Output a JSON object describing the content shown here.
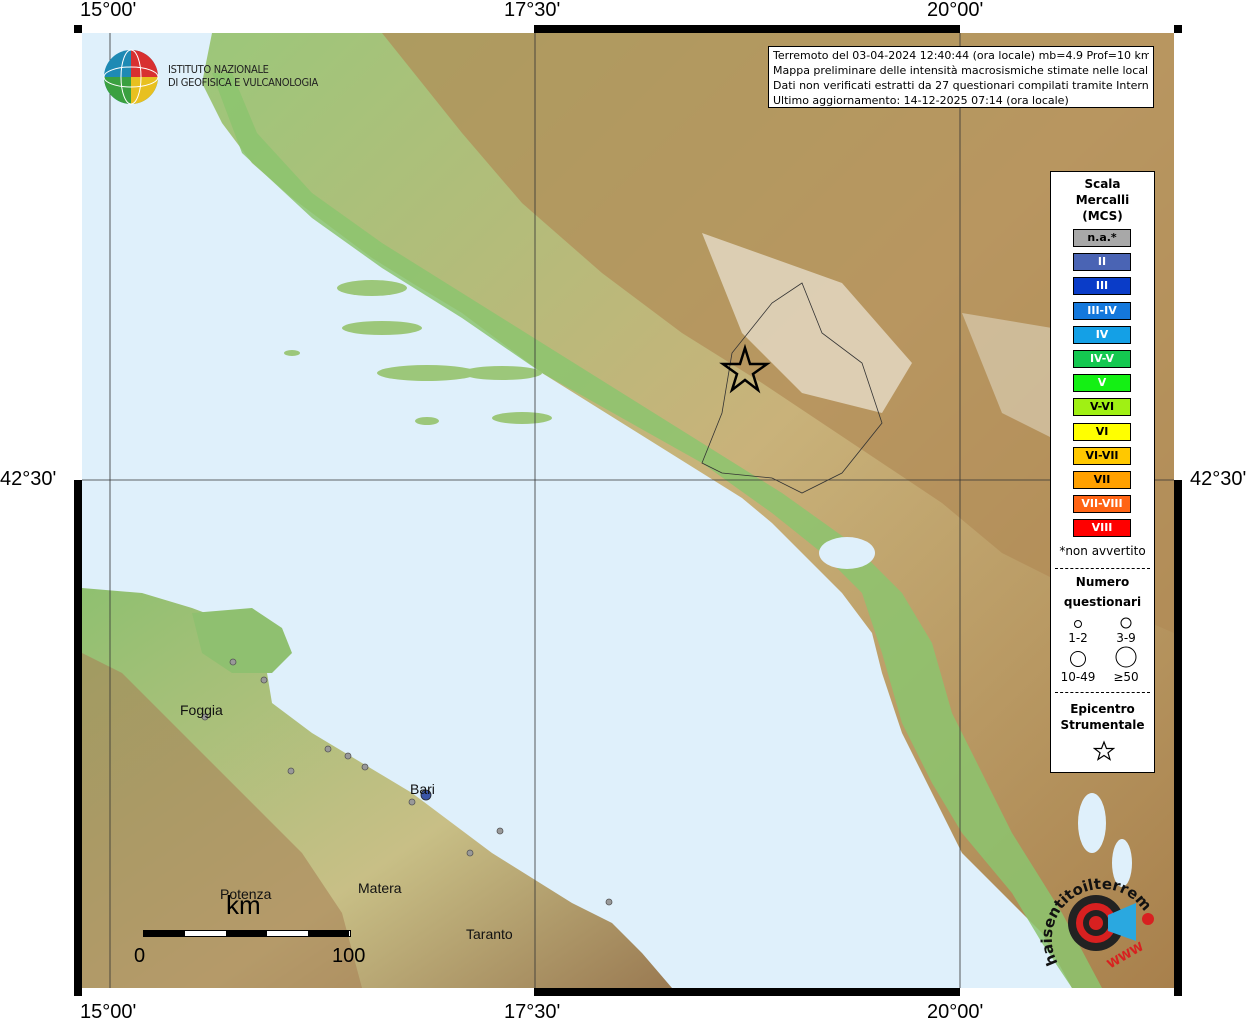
{
  "lon_labels": [
    "15°00'",
    "17°30'",
    "20°00'"
  ],
  "lat_label": "42°30'",
  "info": {
    "line1": "Terremoto del 03-04-2024 12:40:44 (ora locale) mb=4.9 Prof=10 km",
    "line2": "Mappa preliminare delle intensità macrosismiche stimate nelle località",
    "line3": "Dati non verificati estratti da 27 questionari compilati tramite Internet.",
    "line4": "Ultimo aggiornamento: 14-12-2025 07:14 (ora locale)"
  },
  "logo": {
    "line1": "ISTITUTO NAZIONALE",
    "line2": "DI GEOFISICA E VULCANOLOGIA"
  },
  "legend": {
    "title1": "Scala",
    "title2": "Mercalli",
    "title3": "(MCS)",
    "items": [
      {
        "label": "n.a.*",
        "color": "#a8a8a8"
      },
      {
        "label": "II",
        "color": "#4a64b4"
      },
      {
        "label": "III",
        "color": "#0a3cc8"
      },
      {
        "label": "III-IV",
        "color": "#1478dc"
      },
      {
        "label": "IV",
        "color": "#14a0e6"
      },
      {
        "label": "IV-V",
        "color": "#14c850"
      },
      {
        "label": "V",
        "color": "#14f014"
      },
      {
        "label": "V-VI",
        "color": "#a0f014"
      },
      {
        "label": "VI",
        "color": "#ffff00"
      },
      {
        "label": "VI-VII",
        "color": "#ffc800"
      },
      {
        "label": "VII",
        "color": "#ffa000"
      },
      {
        "label": "VII-VIII",
        "color": "#ff6414"
      },
      {
        "label": "VIII",
        "color": "#ff0000"
      }
    ],
    "na_note": "*non avvertito",
    "count_title1": "Numero",
    "count_title2": "questionari",
    "counts": [
      "1-2",
      "3-9",
      "10-49",
      "≥50"
    ],
    "epi_title1": "Epicentro",
    "epi_title2": "Strumentale"
  },
  "cities": [
    "Foggia",
    "Bari",
    "Matera",
    "Potenza",
    "Taranto"
  ],
  "scale_bar": {
    "unit": "km",
    "start": "0",
    "end": "100"
  },
  "badge": {
    "text": "haisentitoilterremoto.it",
    "www": "WWW"
  }
}
